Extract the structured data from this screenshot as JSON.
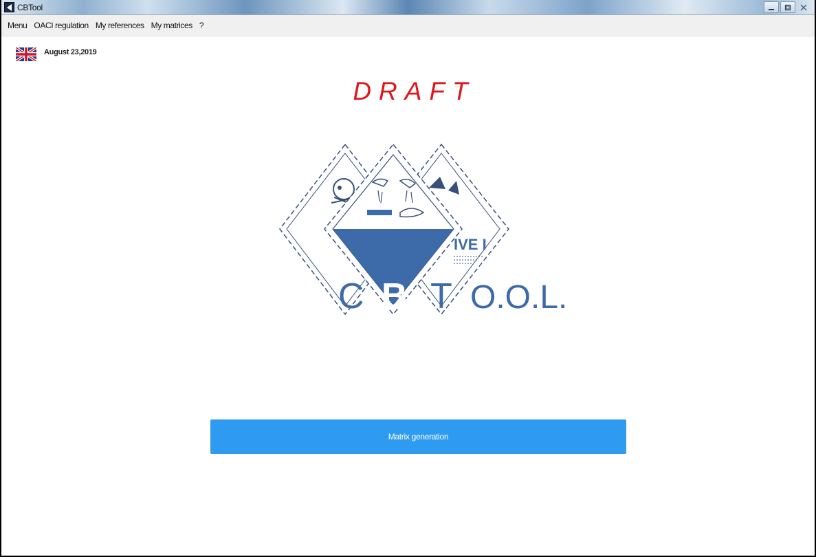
{
  "window": {
    "title": "CBTool",
    "controls": [
      "minimize",
      "restore",
      "close"
    ]
  },
  "menu": {
    "items": [
      {
        "label": "Menu"
      },
      {
        "label": "OACI regulation"
      },
      {
        "label": "My references"
      },
      {
        "label": "My matrices"
      },
      {
        "label": "?"
      }
    ]
  },
  "header": {
    "language_icon": "uk-flag-icon",
    "date": "August 23,2019",
    "draft_label": "DRAFT"
  },
  "logo": {
    "letters": [
      "C",
      "B",
      "T",
      "O.O.L."
    ],
    "partial_text": "IVE I",
    "colors": {
      "primary": "#3d6aa8",
      "outline": "#37507a"
    }
  },
  "actions": {
    "matrix_generation_label": "Matrix generation"
  },
  "colors": {
    "draft": "#e0161b",
    "button": "#2e9bf0"
  }
}
